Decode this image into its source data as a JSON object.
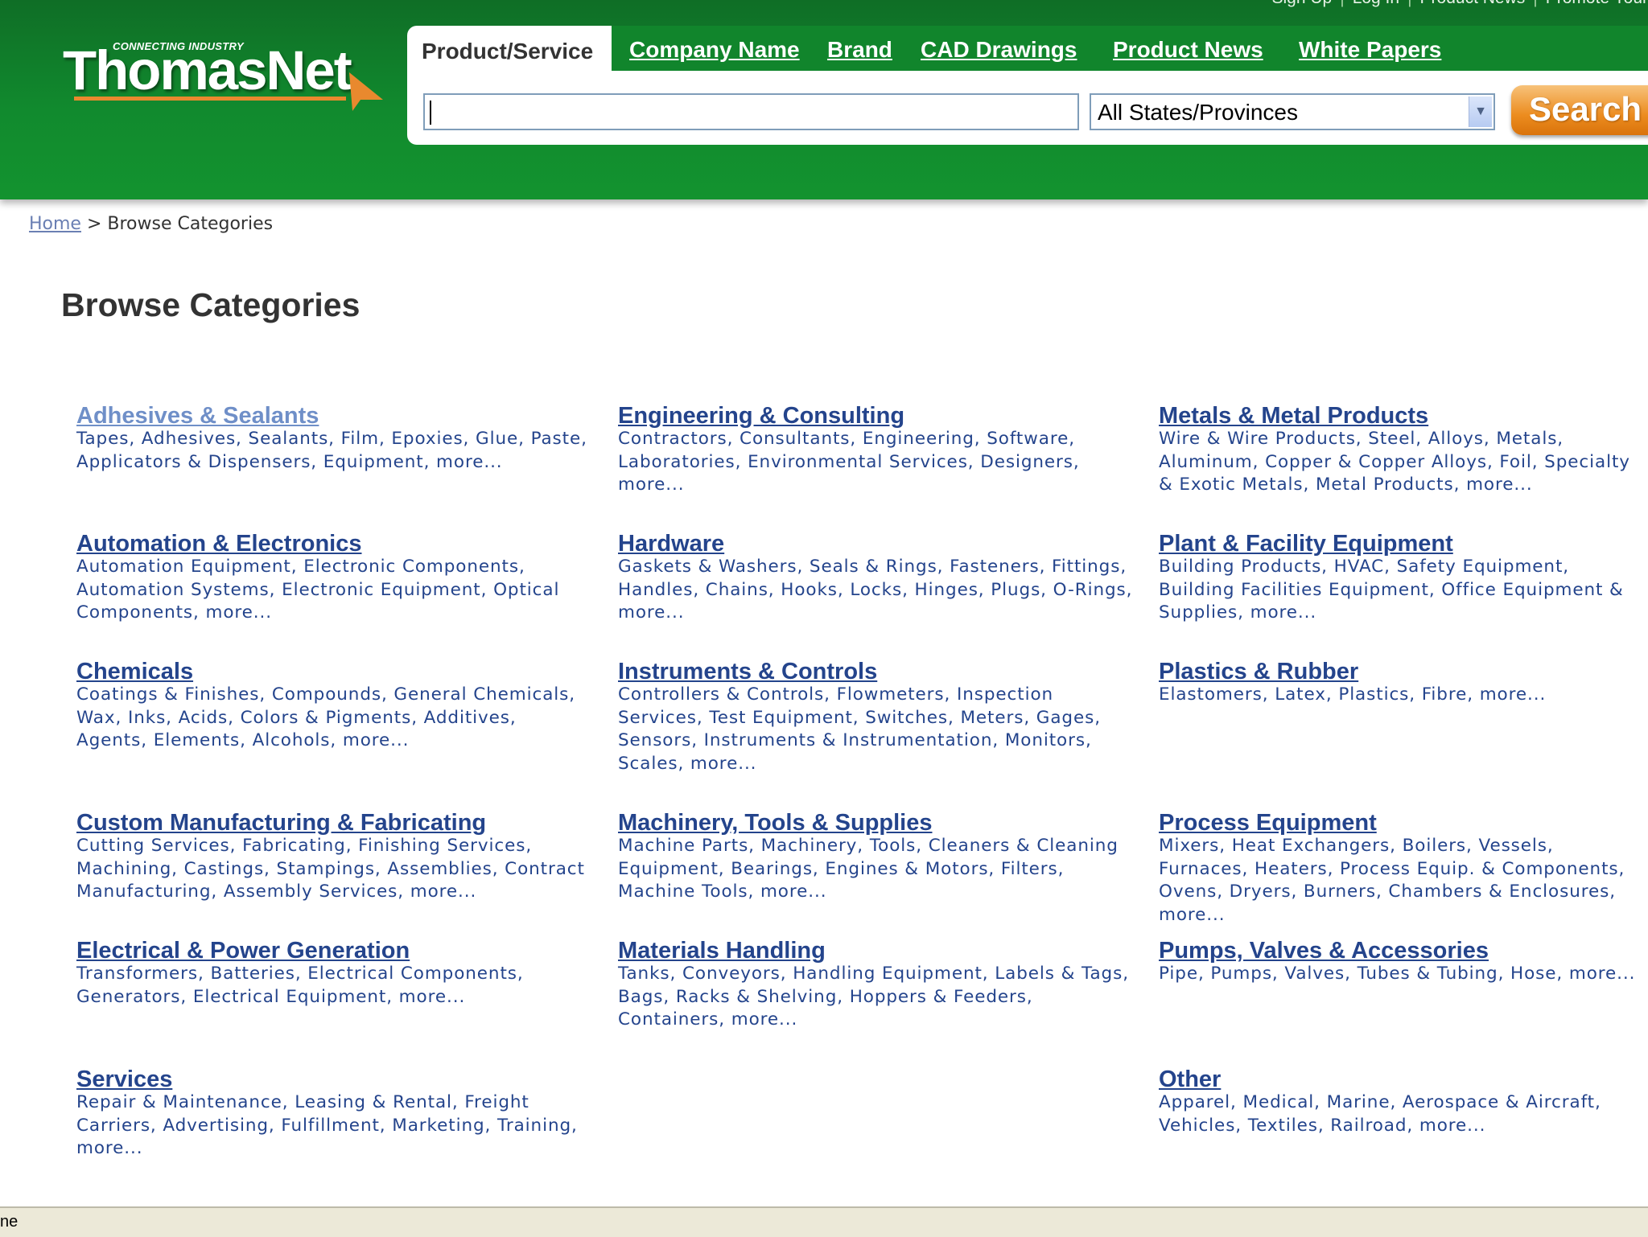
{
  "header": {
    "top_links": [
      "Sign Up",
      "Log In",
      "Product News",
      "Promote Your"
    ],
    "logo_tagline": "CONNECTING INDUSTRY",
    "logo_name": "ThomasNet",
    "tabs": [
      {
        "label": "Product/Service",
        "active": true
      },
      {
        "label": "Company Name"
      },
      {
        "label": "Brand"
      },
      {
        "label": "CAD Drawings"
      },
      {
        "label": "Product News"
      },
      {
        "label": "White Papers"
      }
    ],
    "search_value": "",
    "state_select": "All States/Provinces",
    "search_button": "Search"
  },
  "breadcrumb": {
    "home": "Home",
    "separator": ">",
    "current": "Browse Categories"
  },
  "page_title": "Browse Categories",
  "categories": [
    {
      "title": "Adhesives & Sealants",
      "items": "Tapes, Adhesives, Sealants, Film, Epoxies, Glue, Paste, Applicators & Dispensers, Equipment, more..."
    },
    {
      "title": "Automation & Electronics",
      "items": "Automation Equipment, Electronic Components, Automation Systems, Electronic Equipment, Optical Components, more..."
    },
    {
      "title": "Chemicals",
      "items": "Coatings & Finishes, Compounds, General Chemicals, Wax, Inks, Acids, Colors & Pigments, Additives, Agents, Elements, Alcohols, more..."
    },
    {
      "title": "Custom Manufacturing & Fabricating",
      "items": "Cutting Services, Fabricating, Finishing Services, Machining, Castings, Stampings, Assemblies, Contract Manufacturing, Assembly Services, more..."
    },
    {
      "title": "Electrical & Power Generation",
      "items": "Transformers, Batteries, Electrical Components, Generators, Electrical Equipment, more..."
    },
    {
      "title": "Services",
      "items": "Repair & Maintenance, Leasing & Rental, Freight Carriers, Advertising, Fulfillment, Marketing, Training, more..."
    },
    {
      "title": "Engineering & Consulting",
      "items": "Contractors, Consultants, Engineering, Software, Laboratories, Environmental Services, Designers, more..."
    },
    {
      "title": "Hardware",
      "items": "Gaskets & Washers, Seals & Rings, Fasteners, Fittings, Handles, Chains, Hooks, Locks, Hinges, Plugs, O-Rings, more..."
    },
    {
      "title": "Instruments & Controls",
      "items": "Controllers & Controls, Flowmeters, Inspection Services, Test Equipment, Switches, Meters, Gages, Sensors, Instruments & Instrumentation, Monitors, Scales, more..."
    },
    {
      "title": "Machinery, Tools & Supplies",
      "items": "Machine Parts, Machinery, Tools, Cleaners & Cleaning Equipment, Bearings, Engines & Motors, Filters, Machine Tools, more..."
    },
    {
      "title": "Materials Handling",
      "items": "Tanks, Conveyors, Handling Equipment, Labels & Tags, Bags, Racks & Shelving, Hoppers & Feeders, Containers, more..."
    },
    {
      "title": "Metals & Metal Products",
      "items": "Wire & Wire Products, Steel, Alloys, Metals, Aluminum, Copper & Copper Alloys, Foil, Specialty & Exotic Metals, Metal Products, more..."
    },
    {
      "title": "Plant & Facility Equipment",
      "items": "Building Products, HVAC, Safety Equipment, Building Facilities Equipment, Office Equipment & Supplies, more..."
    },
    {
      "title": "Plastics & Rubber",
      "items": "Elastomers, Latex, Plastics, Fibre, more..."
    },
    {
      "title": "Process Equipment",
      "items": "Mixers, Heat Exchangers, Boilers, Vessels, Furnaces, Heaters, Process Equip. & Components, Ovens, Dryers, Burners, Chambers & Enclosures, more..."
    },
    {
      "title": "Pumps, Valves & Accessories",
      "items": "Pipe, Pumps, Valves, Tubes & Tubing, Hose, more..."
    },
    {
      "title": "Other",
      "items": "Apparel, Medical, Marine, Aerospace & Aircraft, Vehicles, Textiles, Railroad, more..."
    }
  ],
  "status_bar": "ne",
  "colors": {
    "header_green": "#118a2e",
    "link_blue": "#24448c",
    "visited_blue": "#6f8fc8",
    "search_orange": "#ec8c1f"
  }
}
